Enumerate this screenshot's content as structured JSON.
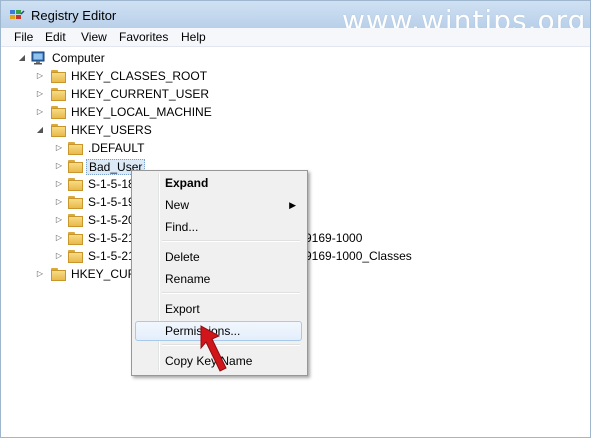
{
  "window": {
    "title": "Registry Editor",
    "watermark": "www.wintips.org"
  },
  "menu": [
    "File",
    "Edit",
    "View",
    "Favorites",
    "Help"
  ],
  "tree": {
    "root": "Computer",
    "hives": {
      "classes_root": "HKEY_CLASSES_ROOT",
      "current_user": "HKEY_CURRENT_USER",
      "local_machine": "HKEY_LOCAL_MACHINE",
      "users": "HKEY_USERS",
      "current_config": "HKEY_CURI"
    },
    "users_children": {
      "default": ".DEFAULT",
      "bad_user": "Bad_User",
      "s1": "S-1-5-18",
      "s2": "S-1-5-19",
      "s3": "S-1-5-20",
      "s4": "S-1-5-21",
      "s4_tail": "9169-1000",
      "s5": "S-1-5-21",
      "s5_tail": "9169-1000_Classes"
    }
  },
  "context_menu": {
    "expand": "Expand",
    "new": "New",
    "find": "Find...",
    "delete": "Delete",
    "rename": "Rename",
    "export": "Export",
    "permissions": "Permissions...",
    "copy_key_name": "Copy Key Name"
  },
  "colors": {
    "accent": "#d0151b",
    "selection": "#dce9f7"
  }
}
